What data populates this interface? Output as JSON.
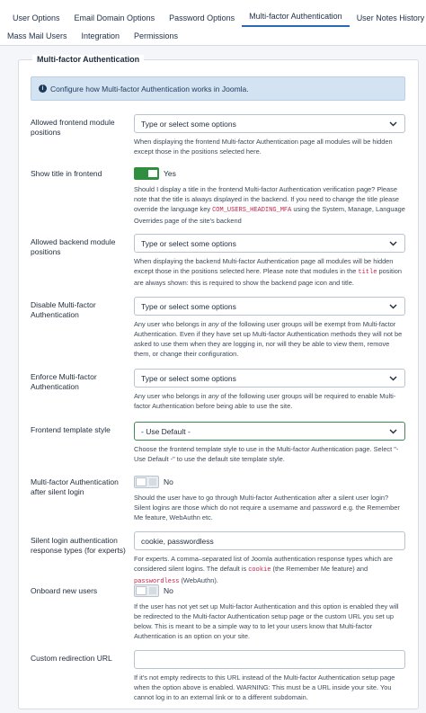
{
  "tabs": {
    "row1": [
      "User Options",
      "Email Domain Options",
      "Password Options",
      "Multi-factor Authentication",
      "User Notes History"
    ],
    "row2": [
      "Mass Mail Users",
      "Integration",
      "Permissions"
    ]
  },
  "fieldset_legend": "Multi-factor Authentication",
  "alert_text": "Configure how Multi-factor Authentication works in Joomla.",
  "fields": {
    "frontend_positions": {
      "label": "Allowed frontend module positions",
      "placeholder": "Type or select some options",
      "help": "When displaying the frontend Multi-factor Authentication page all modules will be hidden except those in the positions selected here."
    },
    "show_title": {
      "label": "Show title in frontend",
      "value": "Yes",
      "help_a": "Should I display a title in the frontend Multi-factor Authentication verification page? Please note that the title is always displayed in the backend. If you need to change the title please override the language key ",
      "help_code": "COM_USERS_HEADING_MFA",
      "help_b": " using the System, Manage, Language Overrides page of the site's backend"
    },
    "backend_positions": {
      "label": "Allowed backend module positions",
      "placeholder": "Type or select some options",
      "help_a": "When displaying the backend Multi-factor Authentication page all modules will be hidden except those in the positions selected here. Please note that modules in the ",
      "help_code": "title",
      "help_b": " position are always shown: this is required to show the backend page icon and title."
    },
    "disable_mfa": {
      "label": "Disable Multi-factor Authentication",
      "placeholder": "Type or select some options",
      "help_a": "Any user who belongs in ",
      "help_em": "any",
      "help_b": " of the following user groups will be exempt from Multi-factor Authentication. Even if they have set up Multi-factor Authentication methods they will not be asked to use them when they are logging in, nor will they be able to view them, remove them, or change their configuration."
    },
    "enforce_mfa": {
      "label": "Enforce Multi-factor Authentication",
      "placeholder": "Type or select some options",
      "help_a": "Any user who belongs in ",
      "help_em": "any",
      "help_b": " of the following user groups will be required to enable Multi-factor Authentication before being able to use the site."
    },
    "frontend_template": {
      "label": "Frontend template style",
      "value": "- Use Default -",
      "help": "Choose the frontend template style to use in the Multi-factor Authentication page. Select \"- Use Default -\" to use the default site template style."
    },
    "after_silent": {
      "label": "Multi-factor Authentication after silent login",
      "value": "No",
      "help": "Should the user have to go through Multi-factor Authentication after a silent user login? Silent logins are those which do not require a username and password e.g. the Remember Me feature, WebAuthn etc."
    },
    "silent_types": {
      "label": "Silent login authentication response types (for experts)",
      "value": "cookie, passwordless",
      "help_a": "For experts. A comma–separated list of Joomla authentication response types which are considered silent logins. The default is ",
      "help_code1": "cookie",
      "help_b": " (the Remember Me feature) and ",
      "help_code2": "passwordless",
      "help_c": " (WebAuthn)."
    },
    "onboard": {
      "label": "Onboard new users",
      "value": "No",
      "help": "If the user has not yet set up Multi-factor Authentication and this option is enabled they will be redirected to the Multi-factor Authentication setup page or the custom URL you set up below. This is meant to be a simple way to to let your users know that Multi-factor Authentication is an option on your site."
    },
    "custom_url": {
      "label": "Custom redirection URL",
      "value": "",
      "help": "If it's not empty redirects to this URL instead of the Multi-factor Authentication setup page when the option above is enabled. WARNING: This must be a URL inside your site. You cannot log in to an external link or to a different subdomain."
    }
  },
  "colors": {
    "accent": "#2a69b8",
    "toggle_on": "#2f8f3f",
    "alert_bg": "#d3e3f2",
    "code": "#c0244e"
  },
  "icons": [
    "info-icon",
    "chevron-down-icon"
  ]
}
